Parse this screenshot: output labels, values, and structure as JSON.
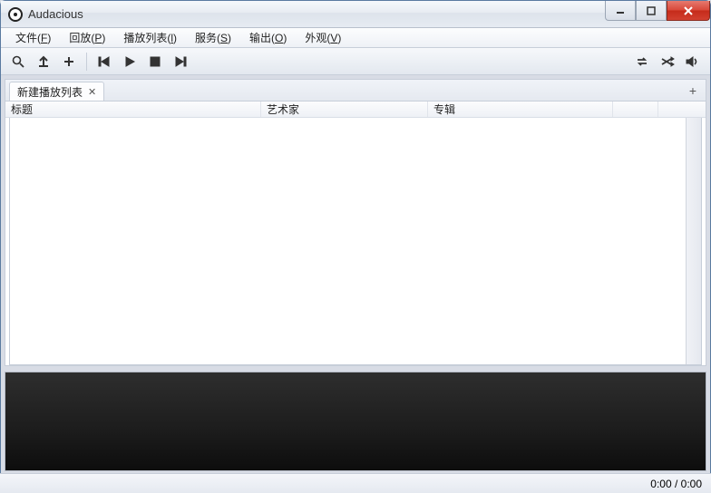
{
  "window": {
    "title": "Audacious"
  },
  "menu": {
    "file": {
      "label": "文件(",
      "key": "F",
      "suffix": ")"
    },
    "playback": {
      "label": "回放(",
      "key": "P",
      "suffix": ")"
    },
    "playlist": {
      "label": "播放列表(",
      "key": "l",
      "suffix": ")"
    },
    "services": {
      "label": "服务(",
      "key": "S",
      "suffix": ")"
    },
    "output": {
      "label": "输出(",
      "key": "O",
      "suffix": ")"
    },
    "view": {
      "label": "外观(",
      "key": "V",
      "suffix": ")"
    }
  },
  "tabs": {
    "current": {
      "label": "新建播放列表"
    }
  },
  "columns": {
    "title": "标题",
    "artist": "艺术家",
    "album": "专辑"
  },
  "status": {
    "time": "0:00 / 0:00"
  },
  "icons": {
    "search": "search-icon",
    "open": "open-icon",
    "add": "add-icon",
    "prev": "previous-icon",
    "play": "play-icon",
    "stop": "stop-icon",
    "next": "next-icon",
    "repeat": "repeat-icon",
    "shuffle": "shuffle-icon",
    "volume": "volume-icon"
  }
}
